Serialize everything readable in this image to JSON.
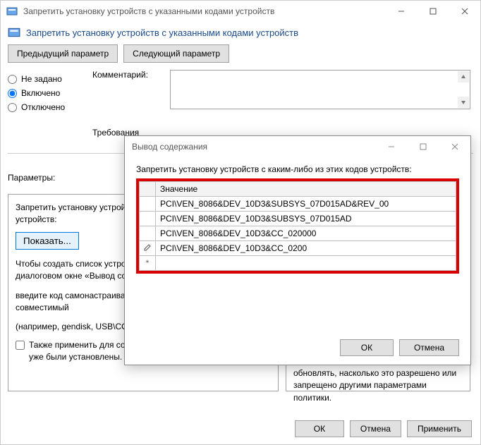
{
  "window": {
    "title": "Запретить установку устройств с указанными кодами устройств",
    "header": "Запретить установку устройств с указанными кодами устройств"
  },
  "nav": {
    "prev": "Предыдущий параметр",
    "next": "Следующий параметр"
  },
  "radios": {
    "not_set": "Не задано",
    "enabled": "Включено",
    "disabled": "Отключено",
    "selected": "enabled"
  },
  "labels": {
    "comment": "Комментарий:",
    "requirements": "Требования",
    "parameters": "Параметры:"
  },
  "left_panel": {
    "line1": "Запретить установку устройств с какими-либо из этих кодов устройств:",
    "show_btn": "Показать...",
    "line2": "Чтобы создать список устройств, нажмите кнопку «Показать». В диалоговом окне «Вывод содержания» в столбце «Значение»",
    "line3": "введите код самонастраивающего оборудования или совместимый",
    "line4": "(например, gendisk, USB\\COMPOSITE, USB\\Class_ff)",
    "chk_label": "Также применить для соответствующих устройств, которые уже были установлены."
  },
  "right_panel": {
    "text": "то новые устройства можно устанавливать, а существующие обновлять, насколько это разрешено или запрещено другими параметрами политики."
  },
  "footer": {
    "ok": "ОК",
    "cancel": "Отмена",
    "apply": "Применить"
  },
  "dialog": {
    "title": "Вывод содержания",
    "instruction": "Запретить установку устройств с каким-либо из этих кодов устройств:",
    "column": "Значение",
    "rows": [
      "PCI\\VEN_8086&DEV_10D3&SUBSYS_07D015AD&REV_00",
      "PCI\\VEN_8086&DEV_10D3&SUBSYS_07D015AD",
      "PCI\\VEN_8086&DEV_10D3&CC_020000",
      "PCI\\VEN_8086&DEV_10D3&CC_0200"
    ],
    "ok": "ОК",
    "cancel": "Отмена"
  }
}
